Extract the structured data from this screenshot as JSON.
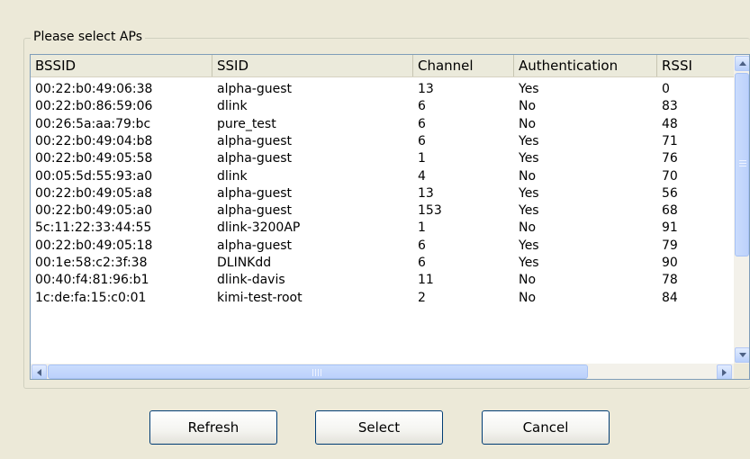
{
  "group": {
    "title": "Please select APs"
  },
  "columns": [
    "BSSID",
    "SSID",
    "Channel",
    "Authentication",
    "RSSI"
  ],
  "rows": [
    [
      "00:22:b0:49:06:38",
      "alpha-guest",
      "13",
      "Yes",
      "0"
    ],
    [
      "00:22:b0:86:59:06",
      "dlink",
      "6",
      "No",
      "83"
    ],
    [
      "00:26:5a:aa:79:bc",
      "pure_test",
      "6",
      "No",
      "48"
    ],
    [
      "00:22:b0:49:04:b8",
      "alpha-guest",
      "6",
      "Yes",
      "71"
    ],
    [
      "00:22:b0:49:05:58",
      "alpha-guest",
      "1",
      "Yes",
      "76"
    ],
    [
      "00:05:5d:55:93:a0",
      "dlink",
      "4",
      "No",
      "70"
    ],
    [
      "00:22:b0:49:05:a8",
      "alpha-guest",
      "13",
      "Yes",
      "56"
    ],
    [
      "00:22:b0:49:05:a0",
      "alpha-guest",
      "153",
      "Yes",
      "68"
    ],
    [
      "5c:11:22:33:44:55",
      "dlink-3200AP",
      "1",
      "No",
      "91"
    ],
    [
      "00:22:b0:49:05:18",
      "alpha-guest",
      "6",
      "Yes",
      "79"
    ],
    [
      "00:1e:58:c2:3f:38",
      "DLINKdd",
      "6",
      "Yes",
      "90"
    ],
    [
      "00:40:f4:81:96:b1",
      "dlink-davis",
      "11",
      "No",
      "78"
    ],
    [
      "1c:de:fa:15:c0:01",
      "kimi-test-root",
      "2",
      "No",
      "84"
    ]
  ],
  "buttons": {
    "refresh": "Refresh",
    "select": "Select",
    "cancel": "Cancel"
  },
  "icons": {
    "scroll_up": "arrow-up-icon",
    "scroll_down": "arrow-down-icon",
    "scroll_left": "arrow-left-icon",
    "scroll_right": "arrow-right-icon"
  }
}
